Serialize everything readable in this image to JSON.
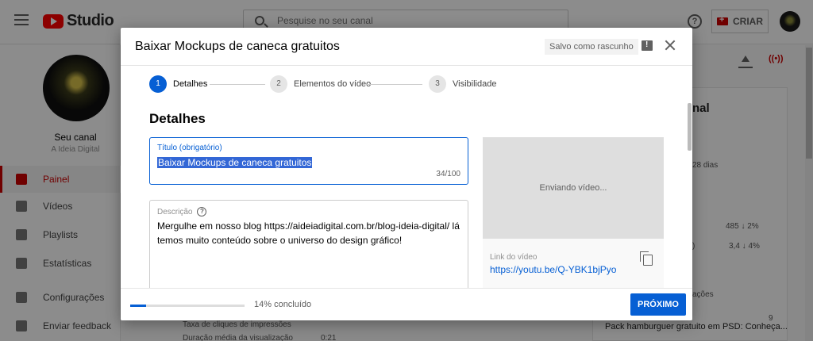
{
  "app": {
    "logo_text": "Studio",
    "search_placeholder": "Pesquise no seu canal",
    "create_label": "CRIAR",
    "help_glyph": "?"
  },
  "sidebar": {
    "channel_name": "Seu canal",
    "channel_sub": "A Ideia Digital",
    "items": [
      {
        "label": "Painel",
        "icon": "dashboard-icon",
        "active": true
      },
      {
        "label": "Vídeos",
        "icon": "video-icon",
        "active": false
      },
      {
        "label": "Playlists",
        "icon": "playlist-icon",
        "active": false
      },
      {
        "label": "Estatísticas",
        "icon": "analytics-icon",
        "active": false
      },
      {
        "label": "Configurações",
        "icon": "gear-icon",
        "active": false
      },
      {
        "label": "Enviar feedback",
        "icon": "feedback-icon",
        "active": false
      }
    ]
  },
  "background": {
    "right_title_fragment": "nal",
    "days": "28 dias",
    "stat_1": "485 ↓ 2%",
    "stat_2": "3,4 ↓ 4%",
    "stat_2_prefix": ")",
    "section_fragment": "ações",
    "video_title": "Pack hamburguer gratuito em PSD: Conheça...",
    "video_count": "9",
    "bottom_row_1": "Taxa de cliques de impressões",
    "bottom_row_2": "Duração média da visualização",
    "bottom_row_2_value": "0:21",
    "live_glyph": "((•))"
  },
  "modal": {
    "title": "Baixar Mockups de caneca gratuitos",
    "draft_status": "Salvo como rascunho",
    "steps": [
      {
        "num": "1",
        "label": "Detalhes",
        "active": true
      },
      {
        "num": "2",
        "label": "Elementos do vídeo",
        "active": false
      },
      {
        "num": "3",
        "label": "Visibilidade",
        "active": false
      }
    ],
    "section_title": "Detalhes",
    "title_field": {
      "label": "Título (obrigatório)",
      "value": "Baixar Mockups de caneca gratuitos",
      "count": "34/100"
    },
    "description_field": {
      "label": "Descrição",
      "help_glyph": "?",
      "value": "Mergulhe em nosso blog https://aideiadigital.com.br/blog-ideia-digital/ lá temos muito conteúdo sobre o universo do design gráfico!"
    },
    "preview": {
      "status": "Enviando vídeo...",
      "link_label": "Link do vídeo",
      "link_value": "https://youtu.be/Q-YBK1bjPyo"
    },
    "footer": {
      "progress_percent": 14,
      "progress_text": "14% concluído",
      "next_label": "PRÓXIMO"
    }
  }
}
